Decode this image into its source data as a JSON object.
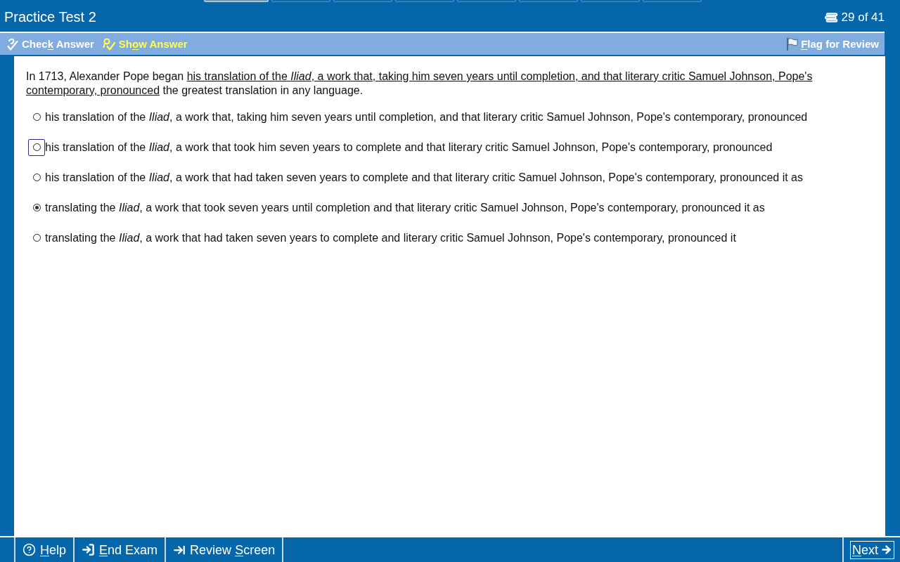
{
  "header_tabs": [
    {
      "selected": true
    },
    {
      "selected": false
    },
    {
      "selected": false
    },
    {
      "selected": false
    },
    {
      "selected": false
    },
    {
      "selected": false
    },
    {
      "selected": false
    },
    {
      "selected": false
    }
  ],
  "window": {
    "title": "Practice Test 2",
    "progress": "29 of 41"
  },
  "toolbar": {
    "items": [
      {
        "kind": "check",
        "before": "Chec",
        "key": "k",
        "after": " Answer",
        "active": false
      },
      {
        "kind": "show",
        "before": "Sh",
        "key": "o",
        "after": "w Answer",
        "active": true
      }
    ],
    "flag": {
      "key": "F",
      "after": "lag for Review"
    }
  },
  "question": {
    "before": "In 1713, Alexander Pope began ",
    "underlined": "his translation of the *Iliad*, a work that, taking him seven years until completion, and that literary critic Samuel Johnson, Pope's contemporary, pronounced",
    "after": " the greatest translation in any language."
  },
  "options": [
    {
      "text": "his translation of the *Iliad*, a work that, taking him seven years until completion, and that literary critic Samuel Johnson, Pope's contemporary, pronounced",
      "selected": false,
      "focused": false
    },
    {
      "text": "his translation of the *Iliad*, a work that took him seven years to complete and that literary critic Samuel Johnson, Pope's contemporary, pronounced",
      "selected": false,
      "focused": true
    },
    {
      "text": "his translation of the *Iliad*, a work that had taken seven years to complete and that literary critic Samuel Johnson, Pope's contemporary, pronounced it as",
      "selected": false,
      "focused": false
    },
    {
      "text": "translating the *Iliad*, a work that took seven years until completion and that literary critic Samuel Johnson, Pope's contemporary, pronounced it as",
      "selected": true,
      "focused": false
    },
    {
      "text": "translating the *Iliad*, a work that had taken seven years to complete and literary critic Samuel Johnson, Pope's contemporary, pronounced it",
      "selected": false,
      "focused": false
    }
  ],
  "footer": {
    "buttons": [
      {
        "kind": "help",
        "key": "H",
        "after": "elp"
      },
      {
        "kind": "end",
        "key": "E",
        "after": "nd Exam"
      },
      {
        "kind": "review",
        "before": "Review ",
        "key": "S",
        "after": "creen"
      }
    ],
    "next": {
      "key": "N",
      "after": "ext"
    }
  }
}
